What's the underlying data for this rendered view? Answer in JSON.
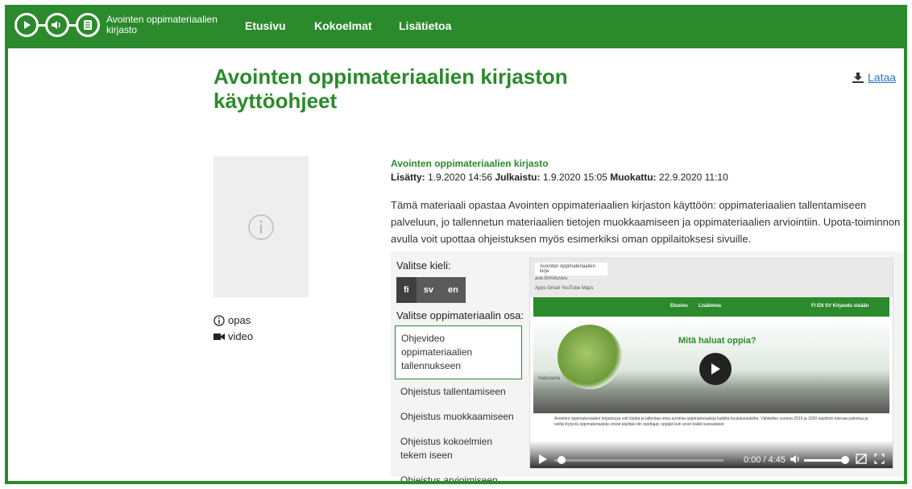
{
  "header": {
    "logo_text": "Avointen oppimateriaalien kirjasto",
    "nav": [
      "Etusivu",
      "Kokoelmat",
      "Lisätietoa"
    ]
  },
  "page": {
    "title": "Avointen oppimateriaalien kirjaston käyttöohjeet",
    "download_label": "Lataa"
  },
  "types": [
    "opas",
    "video"
  ],
  "meta": {
    "source": "Avointen oppimateriaalien kirjasto",
    "added_label": "Lisätty:",
    "added": "1.9.2020 14:56",
    "published_label": "Julkaistu:",
    "published": "1.9.2020 15:05",
    "modified_label": "Muokattu:",
    "modified": "22.9.2020 11:10"
  },
  "description": "Tämä materiaali opastaa Avointen oppimateriaalien kirjaston käyttöön: oppimateriaalien tallentamiseen palveluun, jo tallennetun materiaalien tietojen muokkaamiseen ja oppimateriaalien arviointiin. Upota-toiminnon avulla voit upottaa ohjeistuksen myös esimerkiksi oman oppilaitoksesi sivuille.",
  "panel": {
    "language_label": "Valitse kieli:",
    "languages": [
      "fi",
      "sv",
      "en"
    ],
    "part_label": "Valitse oppimateriaalin osa:",
    "parts": [
      "Ohjevideo oppimateriaalien tallennukseen",
      "Ohjeistus tallentamiseen",
      "Ohjeistus muokkaamiseen",
      "Ohjeistus kokoelmien tekem iseen",
      "Ohjeistus arvioimiseen"
    ]
  },
  "video": {
    "tab": "Avointen oppimateriaalien kirja",
    "url": "aoe.fi/#/etusivu",
    "bookmarks": "Apps  Gmail  YouTube  Maps",
    "site_nav": [
      "Etusivu",
      "Lisätietoa"
    ],
    "site_right": "FI  EN  SV    Kirjaudu sisään",
    "question": "Mitä haluat oppia?",
    "search": "Hakusana",
    "text": "Avointen oppimateriaalien kirjastossa voit löytää ja tallentaa omia avoimia oppimateriaaleja kaikilta koulutusasteilta. Vähitellen vuonna 2019 ja 2020 käyttöön tulevaa palvelua ja sieltä löytyviä oppimateriaaleja voivat käyttää niin opettajat, oppijat kuin arvet kaikki kansalaiset.",
    "time": "0:00 / 4:45"
  },
  "colors": {
    "brand": "#2b8a2b",
    "link": "#2b72b8"
  }
}
